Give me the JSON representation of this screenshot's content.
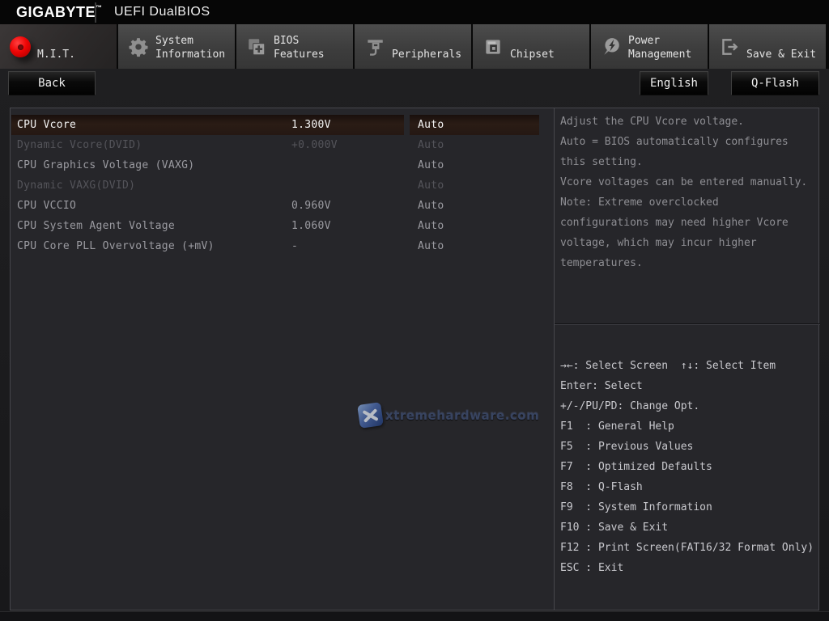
{
  "header": {
    "brand": "GIGABYTE",
    "trademark": "™",
    "title": "UEFI DualBIOS"
  },
  "tabs": [
    {
      "label": "M.I.T.",
      "icon": "mit-red-dot-icon",
      "active": true
    },
    {
      "label": "System Information",
      "icon": "gear-icon",
      "active": false
    },
    {
      "label": "BIOS Features",
      "icon": "pages-plus-icon",
      "active": false
    },
    {
      "label": "Peripherals",
      "icon": "peripheral-icon",
      "active": false
    },
    {
      "label": "Chipset",
      "icon": "chip-icon",
      "active": false
    },
    {
      "label": "Power Management",
      "icon": "power-bolt-icon",
      "active": false
    },
    {
      "label": "Save & Exit",
      "icon": "exit-door-icon",
      "active": false
    }
  ],
  "toolbar": {
    "back": "Back",
    "language": "English",
    "qflash": "Q-Flash"
  },
  "settings": {
    "rows": [
      {
        "label": "CPU Vcore",
        "value": "1.300V",
        "setting": "Auto",
        "state": "selected"
      },
      {
        "label": "Dynamic Vcore(DVID)",
        "value": "+0.000V",
        "setting": "Auto",
        "state": "disabled"
      },
      {
        "label": "CPU Graphics Voltage (VAXG)",
        "value": "",
        "setting": "Auto",
        "state": "normal"
      },
      {
        "label": "Dynamic VAXG(DVID)",
        "value": "",
        "setting": "Auto",
        "state": "disabled"
      },
      {
        "label": "CPU VCCIO",
        "value": "0.960V",
        "setting": "Auto",
        "state": "normal"
      },
      {
        "label": "CPU System Agent Voltage",
        "value": "1.060V",
        "setting": "Auto",
        "state": "normal"
      },
      {
        "label": "CPU Core PLL Overvoltage (+mV)",
        "value": "-",
        "setting": "Auto",
        "state": "normal"
      }
    ]
  },
  "help": {
    "lines": [
      "Adjust the CPU Vcore voltage.",
      "Auto = BIOS automatically configures",
      "this setting.",
      "Vcore voltages can be entered manually.",
      "Note: Extreme overclocked",
      "configurations may need higher Vcore",
      "voltage, which may incur higher",
      "temperatures."
    ]
  },
  "hotkeys": {
    "lines": [
      "→←: Select Screen  ↑↓: Select Item",
      "Enter: Select",
      "+/-/PU/PD: Change Opt.",
      "F1  : General Help",
      "F5  : Previous Values",
      "F7  : Optimized Defaults",
      "F8  : Q-Flash",
      "F9  : System Information",
      "F10 : Save & Exit",
      "F12 : Print Screen(FAT16/32 Format Only)",
      "ESC : Exit"
    ]
  },
  "watermark": {
    "text": "xtremehardware.com"
  },
  "colors": {
    "accent_red": "#ee0505",
    "selected_row_bg": "#2a1c15",
    "content_bg": "#26262a",
    "tab_bg": "#424242",
    "help_text": "#8e8e93"
  }
}
